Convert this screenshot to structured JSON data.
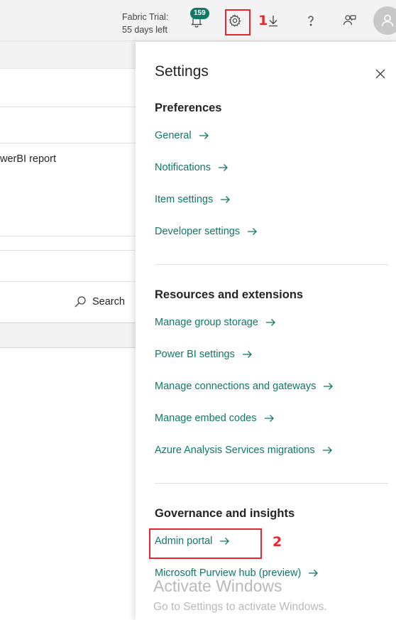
{
  "topbar": {
    "trial_line1": "Fabric Trial:",
    "trial_line2": "55 days left",
    "notification_count": "159",
    "icons": [
      "bell-icon",
      "gear-icon",
      "download-icon",
      "help-icon",
      "people-icon",
      "avatar-icon"
    ]
  },
  "background": {
    "report_text": "werBI report",
    "search_label": "Search"
  },
  "settings": {
    "title": "Settings",
    "sections": [
      {
        "heading": "Preferences",
        "links": [
          "General",
          "Notifications",
          "Item settings",
          "Developer settings"
        ]
      },
      {
        "heading": "Resources and extensions",
        "links": [
          "Manage group storage",
          "Power BI settings",
          "Manage connections and gateways",
          "Manage embed codes",
          "Azure Analysis Services migrations"
        ]
      },
      {
        "heading": "Governance and insights",
        "links": [
          "Admin portal",
          "Microsoft Purview hub (preview)"
        ]
      }
    ]
  },
  "annotations": {
    "step1": "1",
    "step2": "2"
  },
  "watermark": {
    "line1": "Activate Windows",
    "line2": "Go to Settings to activate Windows."
  },
  "colors": {
    "link": "#117865",
    "annotation": "#e8262d",
    "badge": "#117865"
  }
}
